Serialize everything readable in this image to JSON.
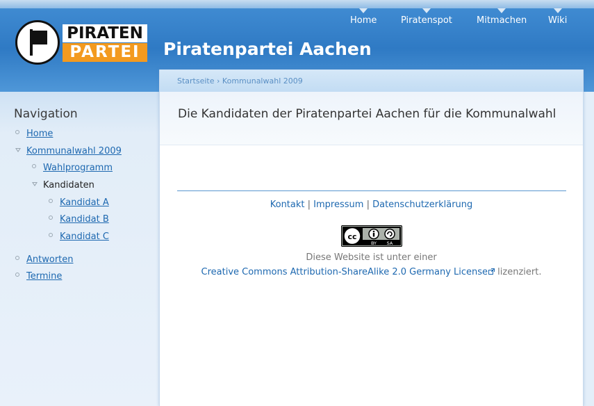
{
  "topnav": {
    "items": [
      {
        "label": "Home"
      },
      {
        "label": "Piratenspot"
      },
      {
        "label": "Mitmachen"
      },
      {
        "label": "Wiki"
      }
    ]
  },
  "logo": {
    "word1": "PIRATEN",
    "word2": "PARTEI"
  },
  "site": {
    "title": "Piratenpartei Aachen"
  },
  "colors": {
    "header_blue": "#2f7ac4",
    "link": "#1d68b0",
    "logo_orange": "#f39a1f"
  },
  "breadcrumb": {
    "home": "Startseite",
    "separator": "›",
    "current": "Kommunalwahl 2009"
  },
  "page": {
    "title": "Die Kandidaten der Piratenpartei Aachen für die Kommunalwahl"
  },
  "sidebar": {
    "heading": "Navigation",
    "items": {
      "home": "Home",
      "kommunalwahl": "Kommunalwahl 2009",
      "wahlprogramm": "Wahlprogramm",
      "kandidaten": "Kandidaten",
      "kandidat_a": "Kandidat A",
      "kandidat_b": "Kandidat B",
      "kandidat_c": "Kandidat C",
      "antworten": "Antworten",
      "termine": "Termine"
    }
  },
  "footer": {
    "kontakt": "Kontakt",
    "impressum": "Impressum",
    "datenschutz": "Datenschutzerklärung",
    "sep": "|",
    "cc_by": "BY",
    "cc_sa": "SA",
    "license_line1": "Diese Website ist unter einer",
    "license_link": "Creative Commons Attribution-ShareAlike 2.0 Germany License",
    "license_suffix": "lizenziert."
  }
}
